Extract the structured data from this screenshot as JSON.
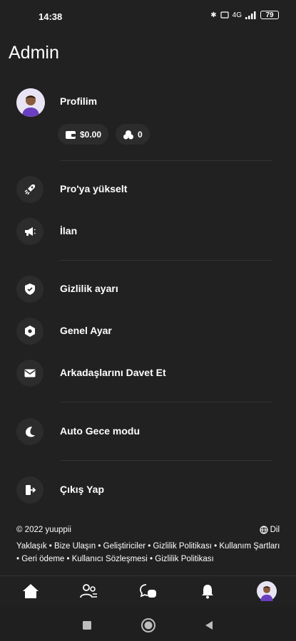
{
  "status": {
    "time": "14:38",
    "bluetooth": "✱",
    "signal_label": "4G",
    "battery": "79"
  },
  "header": {
    "title": "Admin"
  },
  "profile": {
    "label": "Profilim",
    "balance": "$0.00",
    "coins": "0"
  },
  "menu": [
    {
      "label": "Pro'ya yükselt",
      "icon": "rocket-icon"
    },
    {
      "label": "İlan",
      "icon": "megaphone-icon"
    },
    {
      "label": "Gizlilik ayarı",
      "icon": "shield-check-icon"
    },
    {
      "label": "Genel Ayar",
      "icon": "gear-icon"
    },
    {
      "label": "Arkadaşlarını Davet Et",
      "icon": "envelope-icon"
    },
    {
      "label": "Auto Gece modu",
      "icon": "moon-icon"
    },
    {
      "label": "Çıkış Yap",
      "icon": "logout-icon"
    }
  ],
  "footer": {
    "copyright": "© 2022 yuuppii",
    "language": "Dil",
    "links": [
      "Yaklaşık",
      "Bize Ulaşın",
      "Geliştiriciler",
      "Gizlilik Politikası",
      "Kullanım Şartları",
      "Geri ödeme",
      "Kullanıcı Sözleşmesi",
      "Gizlilik Politikası"
    ]
  },
  "bottom_nav": [
    "home-icon",
    "people-icon",
    "chat-icon",
    "bell-icon",
    "avatar"
  ],
  "colors": {
    "background": "#212121",
    "surface": "#2c2c2c",
    "text": "#ffffff",
    "avatar_shirt": "#6a3fc0"
  }
}
